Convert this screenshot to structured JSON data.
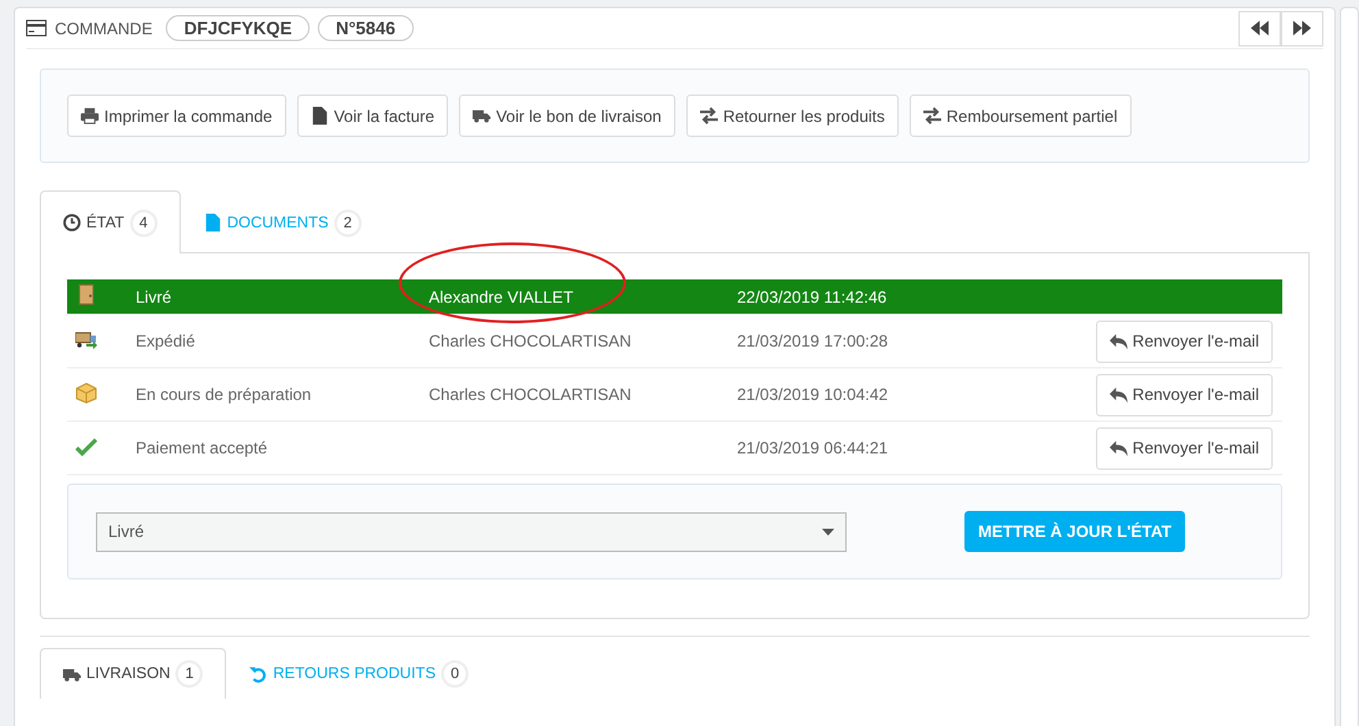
{
  "header": {
    "title": "COMMANDE",
    "reference": "DFJCFYKQE",
    "number": "N°5846"
  },
  "actions": [
    {
      "label": "Imprimer la commande",
      "kind": "print"
    },
    {
      "label": "Voir la facture",
      "kind": "file"
    },
    {
      "label": "Voir le bon de livraison",
      "kind": "truck"
    },
    {
      "label": "Retourner les produits",
      "kind": "exchange"
    },
    {
      "label": "Remboursement partiel",
      "kind": "exchange"
    }
  ],
  "tabs": [
    {
      "label": "ÉTAT",
      "count": "4",
      "kind": "clock",
      "selected": true
    },
    {
      "label": "DOCUMENTS",
      "count": "2",
      "kind": "file",
      "selected": false
    }
  ],
  "history": [
    {
      "kind": "door",
      "status": "Livré",
      "employee": "Alexandre VIALLET",
      "date": "22/03/2019 11:42:46",
      "current": true,
      "annotated": true
    },
    {
      "kind": "truck",
      "status": "Expédié",
      "employee": "Charles CHOCOLARTISAN",
      "date": "21/03/2019 17:00:28",
      "current": false,
      "annotated": false,
      "button": "Renvoyer l'e-mail"
    },
    {
      "kind": "box",
      "status": "En cours de préparation",
      "employee": "Charles CHOCOLARTISAN",
      "date": "21/03/2019 10:04:42",
      "current": false,
      "annotated": false,
      "button": "Renvoyer l'e-mail"
    },
    {
      "kind": "check",
      "status": "Paiement accepté",
      "date": "21/03/2019 06:44:21",
      "current": false,
      "annotated": false,
      "button": "Renvoyer l'e-mail"
    }
  ],
  "state_form": {
    "value": "Livré",
    "button": "METTRE À JOUR L'ÉTAT"
  },
  "bottom_tabs": [
    {
      "label": "LIVRAISON",
      "count": "1",
      "kind": "truck",
      "selected": true
    },
    {
      "label": "RETOURS PRODUITS",
      "count": "0",
      "kind": "undo",
      "selected": false
    }
  ]
}
